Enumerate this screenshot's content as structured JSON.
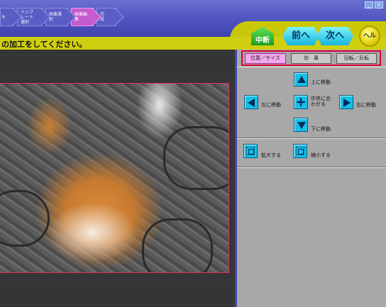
{
  "window": {
    "minimize_glyph": "_",
    "close_glyph": "×"
  },
  "steps": [
    {
      "label": "R"
    },
    {
      "label": "テンプレート\n選択"
    },
    {
      "label": "画像選択"
    },
    {
      "label": "画像編集"
    },
    {
      "label": "完　成"
    }
  ],
  "nav": {
    "stop_label": "中断",
    "prev_label": "前へ",
    "next_label": "次へ",
    "help_label": "ヘルプ"
  },
  "instruction": "の加工をしてください。",
  "tabs": [
    {
      "label": "位置／サイズ",
      "active": true
    },
    {
      "label": "効　果",
      "active": false
    },
    {
      "label": "回転／反転",
      "active": false
    }
  ],
  "controls": {
    "move_up": "上に移動",
    "move_left": "左に移動",
    "center": "中央に合\nわせる",
    "move_right": "右に移動",
    "move_down": "下に移動",
    "zoom_in": "拡大する",
    "zoom_out": "縮小する"
  },
  "icons": {
    "up": "up-arrow-icon",
    "down": "down-arrow-icon",
    "left": "left-arrow-icon",
    "right": "right-arrow-icon",
    "center": "center-crosshair-icon",
    "zoom_in": "zoom-in-icon",
    "zoom_out": "zoom-out-icon"
  },
  "colors": {
    "title_bar": "#4f54bf",
    "instruction_bar": "#cfcf10",
    "active_step": "#c65ad0",
    "active_tab": "#f3a7ee",
    "highlight_border": "#e0003a",
    "arrow_button": "#15c0e6",
    "panel": "#a8a8a8"
  }
}
